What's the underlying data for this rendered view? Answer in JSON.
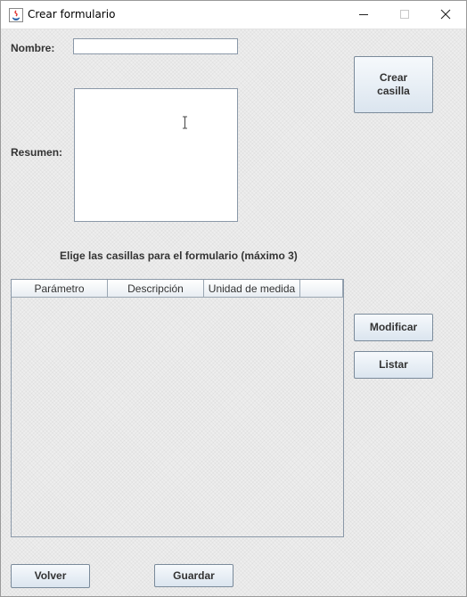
{
  "window": {
    "title": "Crear formulario"
  },
  "form": {
    "nombre_label": "Nombre:",
    "nombre_value": "",
    "resumen_label": "Resumen:",
    "resumen_value": "",
    "instructions": "Elige las casillas para el formulario (máximo 3)"
  },
  "table": {
    "columns": [
      "Parámetro",
      "Descripción",
      "Unidad de medida",
      ""
    ],
    "rows": []
  },
  "buttons": {
    "crear_casilla_line1": "Crear",
    "crear_casilla_line2": "casilla",
    "modificar": "Modificar",
    "listar": "Listar",
    "volver": "Volver",
    "guardar": "Guardar"
  },
  "icons": {
    "app": "java-icon",
    "minimize": "minimize-icon",
    "maximize": "maximize-icon",
    "close": "close-icon"
  }
}
